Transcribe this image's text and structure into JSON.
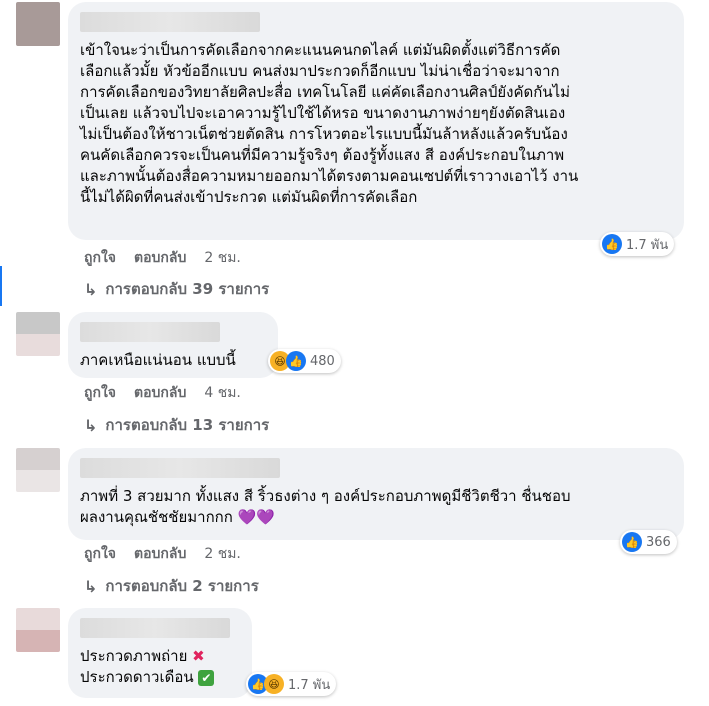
{
  "comments": [
    {
      "text": "เข้าใจนะว่าเป็นการคัดเลือกจากคะแนนคนกดไลค์ แต่มันผิดตั้งแต่วิธีการคัด\nเลือกแล้วมั้ย หัวข้ออีกแบบ คนส่งมาประกวดก็อีกแบบ ไม่น่าเชื่อว่าจะมาจาก\nการคัดเลือกของวิทยาลัยศิลปะสื่อ เทคโนโลยี แค่คัดเลือกงานศิลป์ยังคัดกันไม่\nเป็นเลย แล้วจบไปจะเอาความรู้ไปใช้ได้หรอ ขนาดงานภาพง่ายๆยังตัดสินเอง\nไม่เป็นต้องให้ชาวเน็ตช่วยตัดสิน การโหวตอะไรแบบนี้มันล้าหลังแล้วครับน้อง\nคนคัดเลือกควรจะเป็นคนที่มีความรู้จริงๆ ต้องรู้ทั้งแสง สี องค์ประกอบในภาพ\nและภาพนั้นต้องสื่อความหมายออกมาได้ตรงตามคอนเซปต์ที่เราวางเอาไว้ งาน\nนี้ไม่ได้ผิดที่คนส่งเข้าประกวด แต่มันผิดที่การคัดเลือก",
      "like": "ถูกใจ",
      "reply": "ตอบกลับ",
      "time": "2 ชม.",
      "reactions": "1.7 พัน",
      "replies": "การตอบกลับ 39 รายการ"
    },
    {
      "text": "ภาคเหนือแน่นอน แบบนี้",
      "like": "ถูกใจ",
      "reply": "ตอบกลับ",
      "time": "4 ชม.",
      "reactions": "480",
      "replies": "การตอบกลับ 13 รายการ"
    },
    {
      "text": "ภาพที่ 3 สวยมาก ทั้งแสง สี ริ้วธงต่าง ๆ องค์ประกอบภาพดูมีชีวิตชีวา ชื่นชอบ\nผลงานคุณชัชชัยมากกก",
      "like": "ถูกใจ",
      "reply": "ตอบกลับ",
      "time": "2 ชม.",
      "reactions": "366",
      "replies": "การตอบกลับ 2 รายการ"
    },
    {
      "line1": "ประกวดภาพถ่าย",
      "line2": "ประกวดดาวเดือน",
      "reactions": "1.7 พัน"
    }
  ],
  "icons": {
    "like": "thumbs-up-icon",
    "haha": "laughing-face-icon",
    "heart": "purple-heart-icon",
    "x": "red-cross-icon",
    "check": "green-check-icon",
    "reply_arrow": "reply-arrow-icon"
  },
  "colors": {
    "accent": "#1877f2",
    "bubble": "#f0f2f5",
    "muted": "#65676b"
  }
}
